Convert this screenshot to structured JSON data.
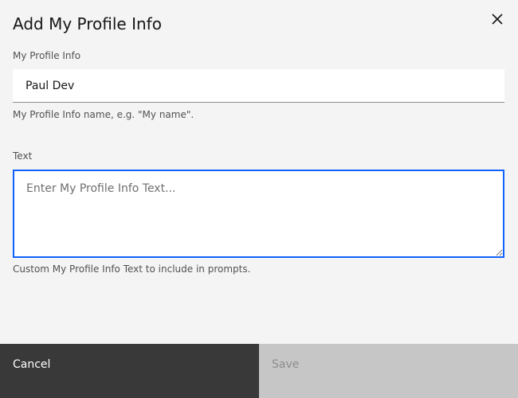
{
  "modal": {
    "title": "Add My Profile Info",
    "close_icon": "close-icon"
  },
  "name_field": {
    "label": "My Profile Info",
    "value": "Paul Dev",
    "helper": "My Profile Info name, e.g. \"My name\"."
  },
  "text_field": {
    "label": "Text",
    "placeholder": "Enter My Profile Info Text...",
    "value": "",
    "helper": "Custom My Profile Info Text to include in prompts."
  },
  "footer": {
    "cancel_label": "Cancel",
    "save_label": "Save"
  },
  "colors": {
    "background": "#f4f4f4",
    "focus_border": "#0f62fe",
    "cancel_bg": "#393939",
    "save_bg_disabled": "#c6c6c6"
  }
}
